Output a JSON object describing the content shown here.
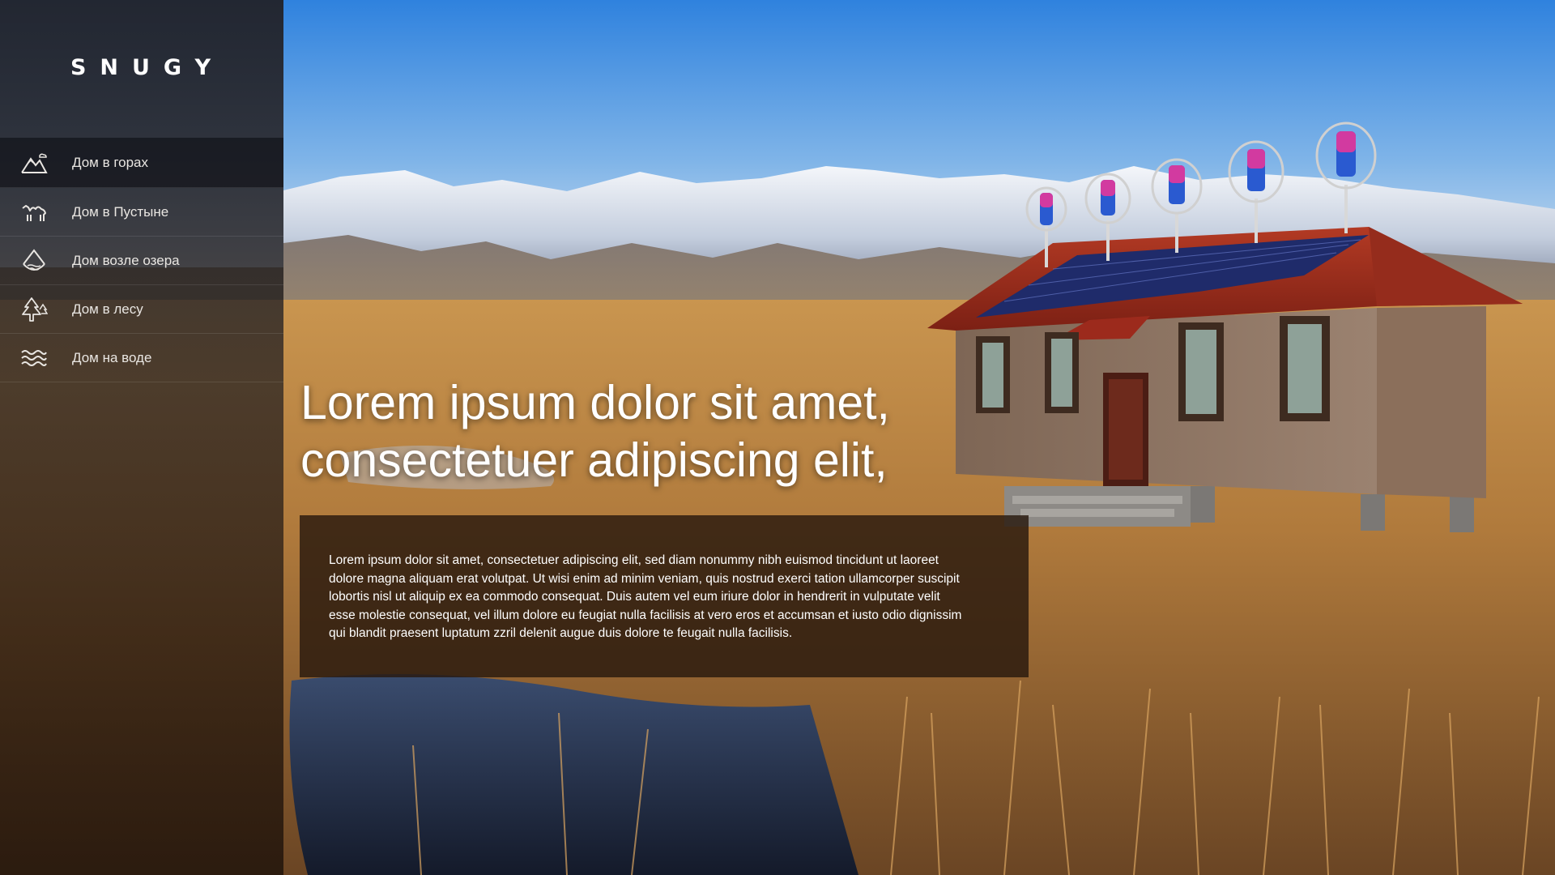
{
  "brand": {
    "logo_text": "SNUGY"
  },
  "sidebar": {
    "items": [
      {
        "label": "Дом в горах",
        "icon": "mountain-icon",
        "active": true
      },
      {
        "label": "Дом в Пустыне",
        "icon": "camel-icon",
        "active": false
      },
      {
        "label": "Дом возле озера",
        "icon": "lake-icon",
        "active": false
      },
      {
        "label": "Дом в лесу",
        "icon": "tree-icon",
        "active": false
      },
      {
        "label": "Дом на воде",
        "icon": "waves-icon",
        "active": false
      }
    ]
  },
  "hero": {
    "headline_line1": "Lorem ipsum dolor sit amet,",
    "headline_line2": "consectetuer adipiscing elit,",
    "body": "Lorem ipsum dolor sit amet, consectetuer adipiscing elit, sed diam nonummy nibh euismod tincidunt ut laoreet dolore magna aliquam erat volutpat. Ut wisi enim ad minim veniam, quis nostrud exerci tation ullamcorper suscipit lobortis nisl ut aliquip ex ea commodo consequat. Duis autem vel eum iriure dolor in hendrerit in vulputate velit esse molestie consequat, vel illum dolore eu feugiat nulla facilisis at vero eros et accumsan et iusto odio dignissim qui blandit praesent luptatum zzril delenit augue duis dolore te feugait nulla facilisis."
  },
  "colors": {
    "sidebar_bg": "#22242c",
    "active_item_bg": "#0a0a0e",
    "text_light": "#e9e6e2",
    "info_box_bg": "#28180e",
    "sky": "#3a8fe0",
    "roof": "#9c2a1c"
  }
}
